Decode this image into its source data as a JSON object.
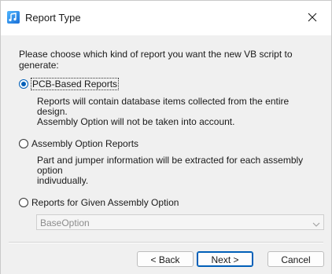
{
  "window": {
    "title": "Report Type",
    "app_icon": "report-script-icon",
    "close_icon": "close-icon"
  },
  "intro": "Please choose which kind of report you want the new VB script to generate:",
  "options": [
    {
      "label": "PCB-Based Reports",
      "checked": true,
      "description_line1": "Reports will contain database items collected from the entire design.",
      "description_line2": "Assembly Option will not be taken into account."
    },
    {
      "label": "Assembly Option Reports",
      "checked": false,
      "description_line1": "Part and jumper information will be extracted for each assembly option",
      "description_line2": "indivudually."
    },
    {
      "label": "Reports for Given Assembly Option",
      "checked": false
    }
  ],
  "assembly_option_select": {
    "value": "BaseOption",
    "enabled": false
  },
  "buttons": {
    "back": "< Back",
    "next": "Next >",
    "cancel": "Cancel"
  },
  "colors": {
    "accent": "#005fb8",
    "background": "#f0f0f0",
    "titlebar": "#ffffff"
  }
}
